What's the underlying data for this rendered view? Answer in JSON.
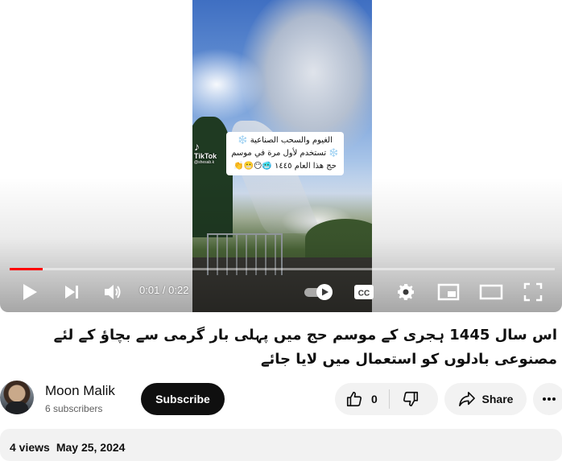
{
  "player": {
    "current_time": "0:01",
    "time_separator": " / ",
    "duration": "0:22",
    "progress_fraction": 0.06,
    "watermark": {
      "brand": "TikTok",
      "handle": "@shesab.k"
    },
    "caption_lines": [
      "الغيوم والسحب الصناعية ❄️",
      "❄️ تستخدم لأول مرة في موسم",
      "حج هذا العام ١٤٤٥ 🥶😶😬👏"
    ],
    "controls": {
      "play_icon": "play-icon",
      "next_icon": "next-icon",
      "volume_icon": "volume-icon",
      "autoplay_icon": "autoplay-toggle-icon",
      "captions_label": "CC",
      "settings_icon": "gear-icon",
      "miniplayer_icon": "miniplayer-icon",
      "theater_icon": "theater-mode-icon",
      "fullscreen_icon": "fullscreen-icon"
    },
    "accent_color": "#ff0000"
  },
  "video": {
    "title": "اس سال 1445 ہجری کے موسم حج میں پہلی بار گرمی سے بچاؤ کے لئے مصنوعی بادلوں کو استعمال میں لایا جائے"
  },
  "channel": {
    "name": "Moon Malik",
    "subscribers": "6 subscribers",
    "subscribe_label": "Subscribe"
  },
  "actions": {
    "like_count": "0",
    "share_label": "Share"
  },
  "description": {
    "views": "4 views",
    "date": "May 25, 2024"
  }
}
